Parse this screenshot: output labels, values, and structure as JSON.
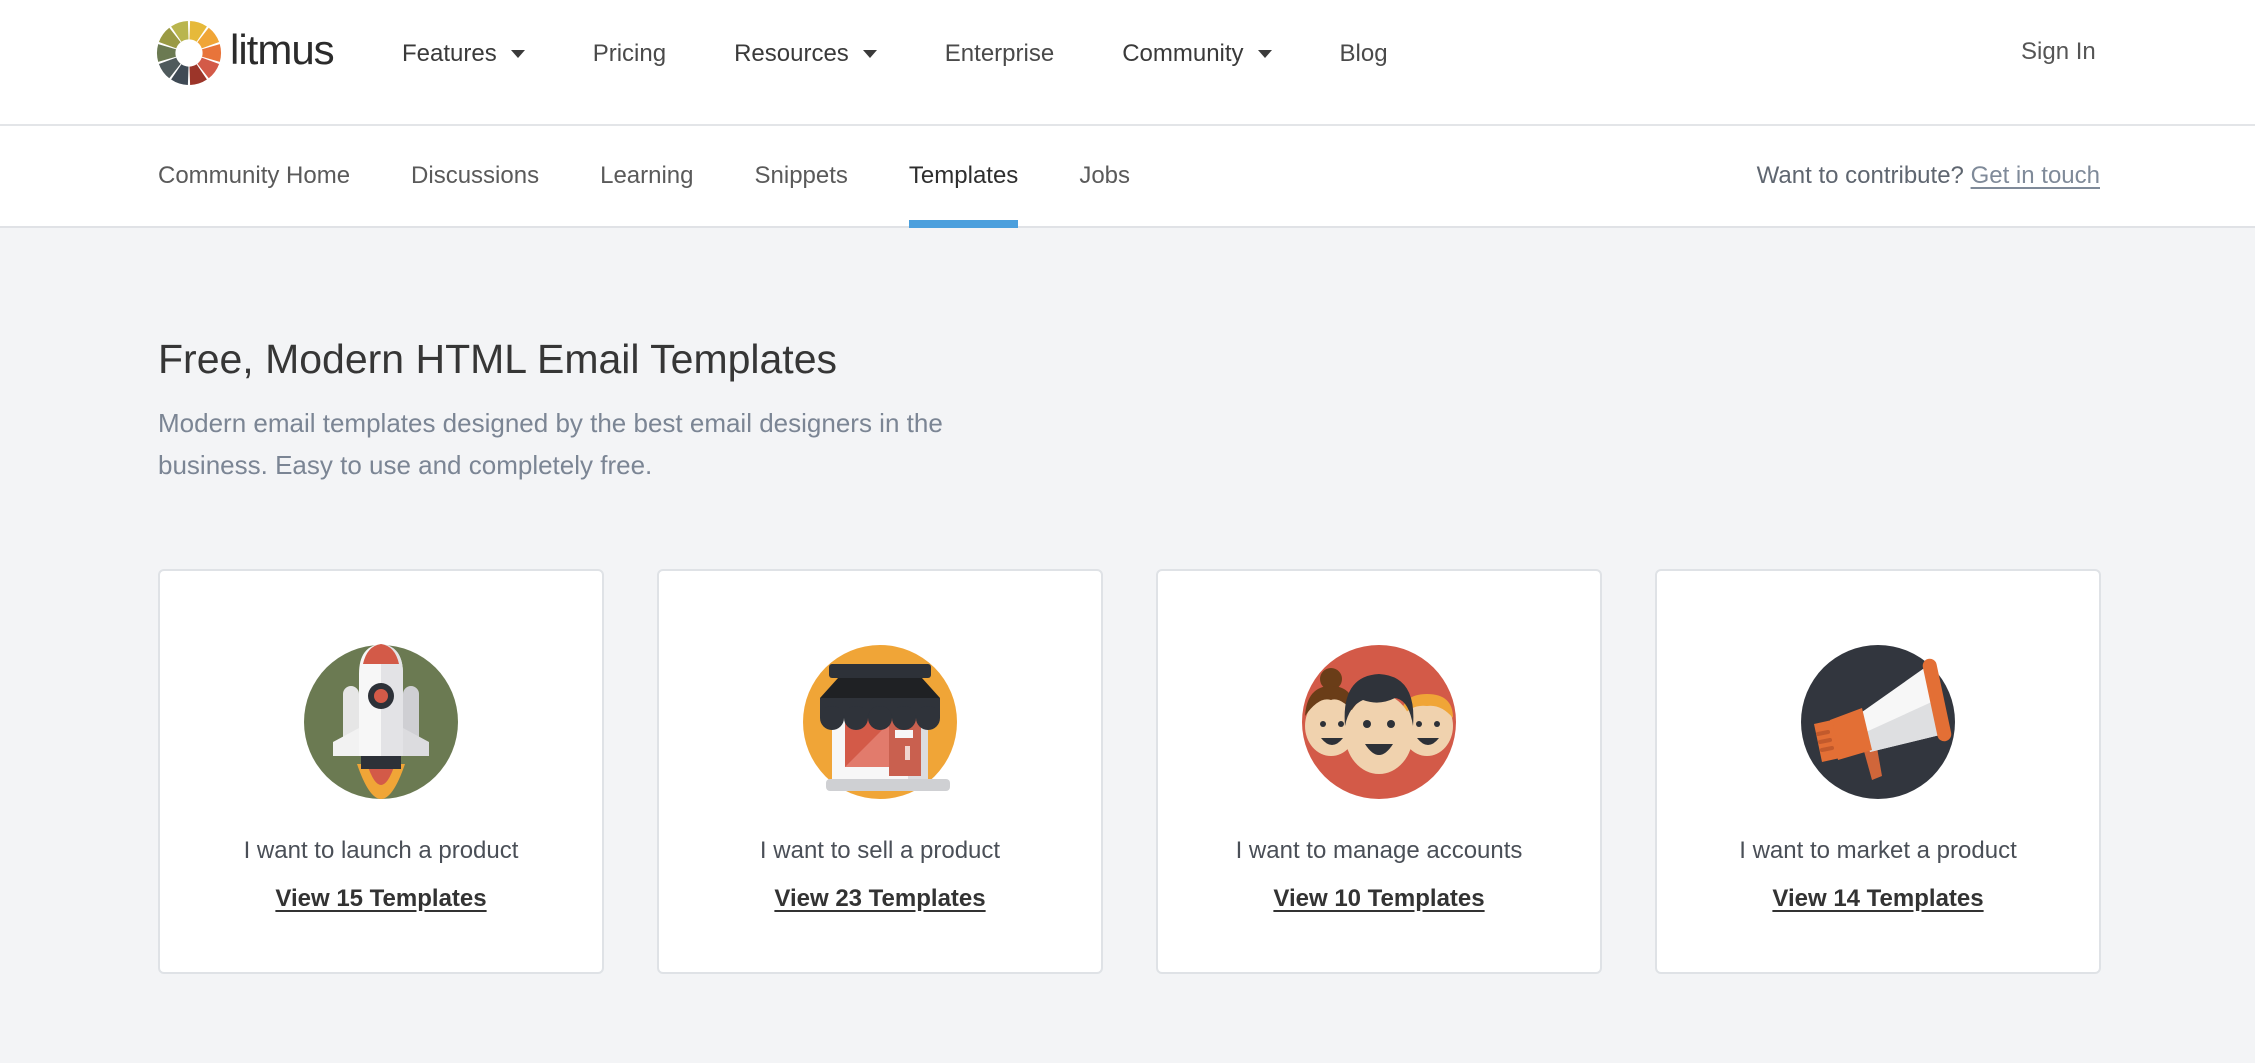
{
  "header": {
    "logo_text": "litmus",
    "nav": [
      {
        "label": "Features",
        "has_dropdown": true
      },
      {
        "label": "Pricing",
        "has_dropdown": false
      },
      {
        "label": "Resources",
        "has_dropdown": true
      },
      {
        "label": "Enterprise",
        "has_dropdown": false
      },
      {
        "label": "Community",
        "has_dropdown": true
      },
      {
        "label": "Blog",
        "has_dropdown": false
      }
    ],
    "sign_in": "Sign In"
  },
  "subnav": {
    "tabs": [
      {
        "label": "Community Home",
        "active": false
      },
      {
        "label": "Discussions",
        "active": false
      },
      {
        "label": "Learning",
        "active": false
      },
      {
        "label": "Snippets",
        "active": false
      },
      {
        "label": "Templates",
        "active": true
      },
      {
        "label": "Jobs",
        "active": false
      }
    ],
    "contribute_prompt": "Want to contribute?",
    "contribute_link": "Get in touch",
    "active_color": "#4b9fdd"
  },
  "hero": {
    "title": "Free, Modern HTML Email Templates",
    "subtitle": "Modern email templates designed by the best email designers in the business. Easy to use and completely free."
  },
  "cards": [
    {
      "icon": "rocket-icon",
      "circle_color": "#6b7a52",
      "label": "I want to launch a product",
      "link": "View 15 Templates"
    },
    {
      "icon": "storefront-icon",
      "circle_color": "#f0a537",
      "label": "I want to sell a product",
      "link": "View 23 Templates"
    },
    {
      "icon": "people-icon",
      "circle_color": "#d35a48",
      "label": "I want to manage accounts",
      "link": "View 10 Templates"
    },
    {
      "icon": "megaphone-icon",
      "circle_color": "#32363e",
      "label": "I want to market a product",
      "link": "View 14 Templates"
    }
  ]
}
